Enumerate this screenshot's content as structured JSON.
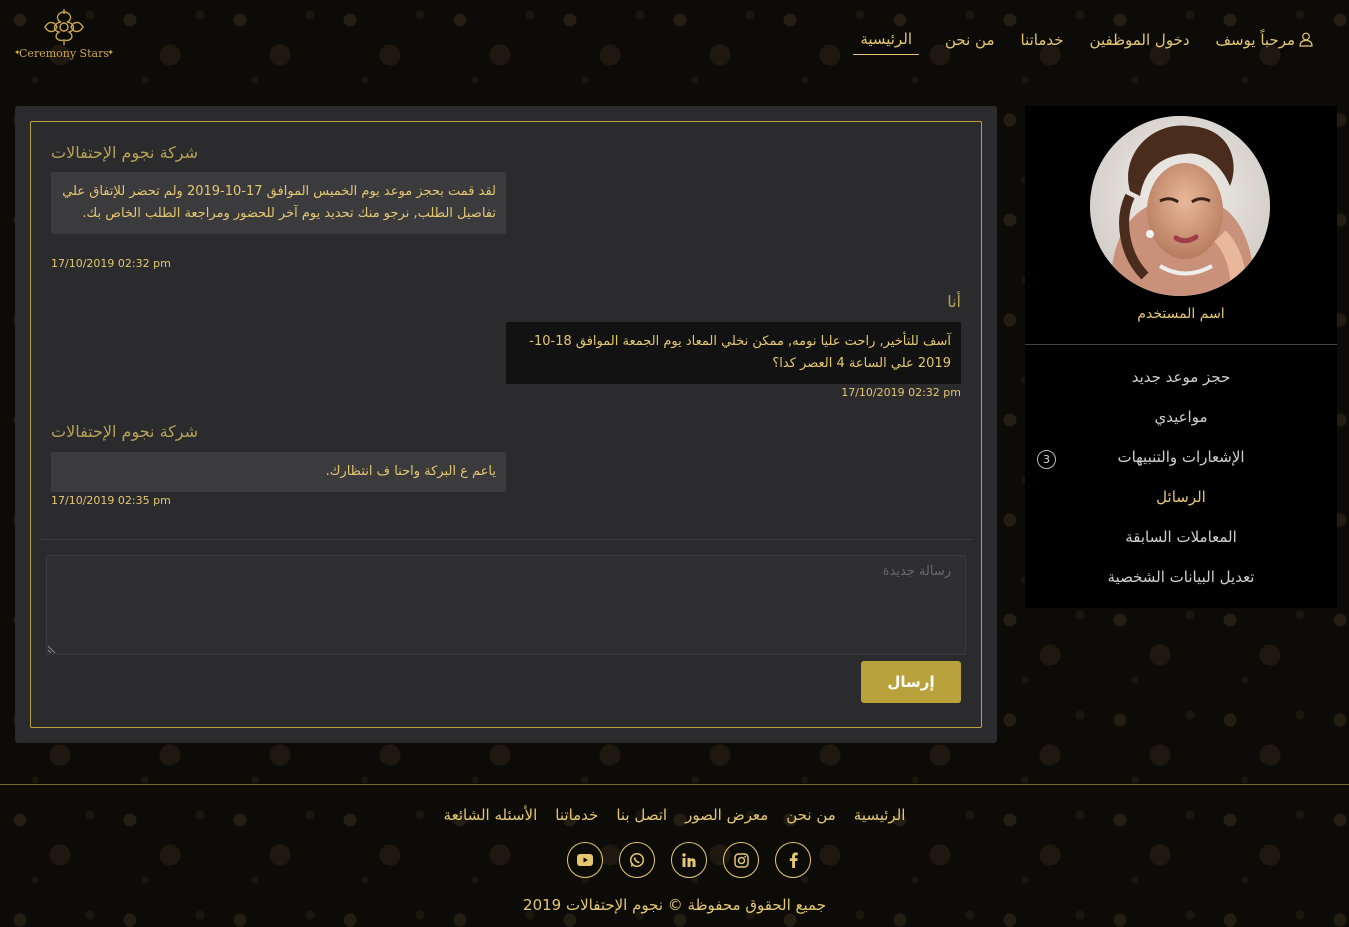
{
  "brand": {
    "logo_text": "Ceremony Stars"
  },
  "nav": {
    "items": [
      {
        "label": "الرئيسية",
        "active": true
      },
      {
        "label": "من نحن"
      },
      {
        "label": "خدماتنا"
      },
      {
        "label": "دخول الموظفين"
      },
      {
        "label": "مرحباً يوسف",
        "icon": "user-icon"
      }
    ]
  },
  "sidebar": {
    "username": "اسم المستخدم",
    "menu": [
      {
        "label": "حجز موعد جديد"
      },
      {
        "label": "مواعيدي"
      },
      {
        "label": "الإشعارات والتنبيهات",
        "badge": "3"
      },
      {
        "label": "الرسائل",
        "active": true
      },
      {
        "label": "المعاملات السابقة"
      },
      {
        "label": "تعديل البيانات الشخصية"
      }
    ]
  },
  "chat": {
    "messages": [
      {
        "sender": "شركة نجوم الإحتفالات",
        "text": "لقد قمت بحجز موعد يوم الخميس الموافق 17-10-2019 ولم تحضر للإتفاق علي تفاصيل الطلب, نرجو منك تحديد يوم آخر للحضور ومراجعة الطلب الخاص بك.",
        "time": "17/10/2019 02:32 pm",
        "from_me": false
      },
      {
        "sender": "أنا",
        "text": "آسف للتأخير, راحت عليا نومه, ممكن نخلي المعاد يوم الجمعة الموافق 18-10-2019 علي الساعة 4 العصر كدا؟",
        "time": "17/10/2019 02:32 pm",
        "from_me": true
      },
      {
        "sender": "شركة نجوم الإحتفالات",
        "text": "ياعم ع البركة واحنا ف انتظارك.",
        "time": "17/10/2019 02:35 pm",
        "from_me": false
      }
    ],
    "compose_placeholder": "رسالة جديدة",
    "send_label": "إرسال"
  },
  "footer": {
    "links": [
      "الرئيسية",
      "من نحن",
      "معرض الصور",
      "اتصل بنا",
      "خدماتنا",
      "الأسئله الشائعة"
    ],
    "socials": [
      "facebook-icon",
      "instagram-icon",
      "linkedin-icon",
      "whatsapp-icon",
      "youtube-icon"
    ],
    "copyright": "جميع الحقوق محفوظة © نجوم الإحتفالات 2019"
  },
  "colors": {
    "gold": "#e4c871",
    "button": "#b9a23c",
    "panel": "#2b2a2c",
    "sidebar": "#000000"
  }
}
